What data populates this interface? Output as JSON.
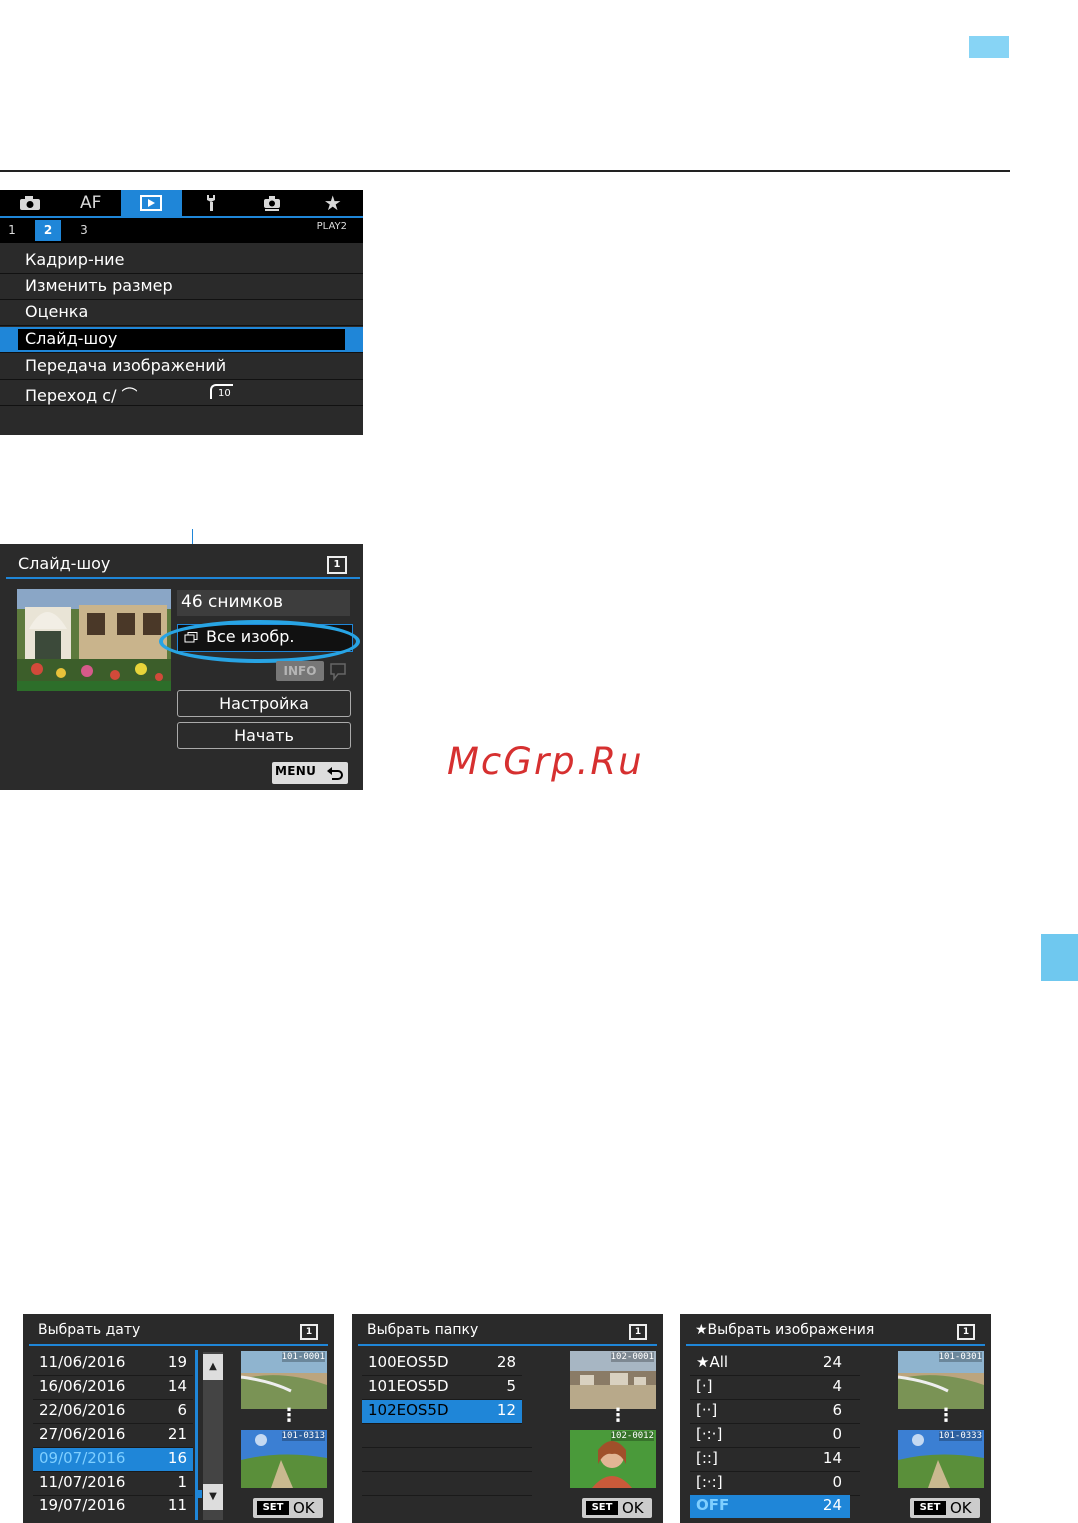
{
  "page": {
    "watermark": "McGrp.Ru"
  },
  "menu_screen": {
    "tabs": [
      {
        "icon": "camera-icon",
        "label": ""
      },
      {
        "icon": "af-text",
        "label": "AF"
      },
      {
        "icon": "play-icon",
        "label": ""
      },
      {
        "icon": "wrench-icon",
        "label": ""
      },
      {
        "icon": "custom-icon",
        "label": ""
      },
      {
        "icon": "star-icon",
        "label": ""
      }
    ],
    "active_tab": 2,
    "subtabs": [
      "1",
      "2",
      "3"
    ],
    "selected_subtab": "2",
    "page_label": "PLAY2",
    "items": [
      {
        "label": "Кадрир-ние"
      },
      {
        "label": "Изменить размер"
      },
      {
        "label": "Оценка"
      },
      {
        "label": "Слайд-шоу"
      },
      {
        "label": "Передача изображений"
      },
      {
        "label": "Переход с/ ⌒"
      }
    ],
    "selected_item": "Слайд-шоу",
    "jump_value": "10",
    "colors": {
      "accent": "#1f86d8",
      "background": "#2a2a2a"
    }
  },
  "slideshow_screen": {
    "title": "Слайд-шоу",
    "corner_num": "1",
    "count": "46 снимков",
    "filter": "Все изобр.",
    "info_label": "INFO",
    "setup_button": "Настройка",
    "start_button": "Начать",
    "menu_label": "MENU"
  },
  "date_screen": {
    "title": "Выбрать дату",
    "corner_num": "1",
    "rows": [
      {
        "date": "11/06/2016",
        "count": "19"
      },
      {
        "date": "16/06/2016",
        "count": "14"
      },
      {
        "date": "22/06/2016",
        "count": "6"
      },
      {
        "date": "27/06/2016",
        "count": "21"
      },
      {
        "date": "09/07/2016",
        "count": "16"
      },
      {
        "date": "11/07/2016",
        "count": "1"
      },
      {
        "date": "19/07/2016",
        "count": "11"
      }
    ],
    "selected": "09/07/2016",
    "thumb_top": "101-0001",
    "thumb_bottom": "101-0313",
    "set_label": "SET",
    "ok_label": "OK"
  },
  "folder_screen": {
    "title": "Выбрать папку",
    "corner_num": "1",
    "rows": [
      {
        "name": "100EOS5D",
        "count": "28"
      },
      {
        "name": "101EOS5D",
        "count": "5"
      },
      {
        "name": "102EOS5D",
        "count": "12"
      }
    ],
    "selected": "102EOS5D",
    "thumb_top": "102-0001",
    "thumb_bottom": "102-0012",
    "set_label": "SET",
    "ok_label": "OK"
  },
  "rating_screen": {
    "title": "★Выбрать изображения",
    "corner_num": "1",
    "rows": [
      {
        "name": "★All",
        "count": "24"
      },
      {
        "name": "[·]",
        "count": "4"
      },
      {
        "name": "[··]",
        "count": "6"
      },
      {
        "name": "[·:·]",
        "count": "0"
      },
      {
        "name": "[::]",
        "count": "14"
      },
      {
        "name": "[:·:]",
        "count": "0"
      },
      {
        "name": "OFF",
        "count": "24"
      }
    ],
    "selected": "OFF",
    "thumb_top": "101-0301",
    "thumb_bottom": "101-0333",
    "set_label": "SET",
    "ok_label": "OK"
  }
}
